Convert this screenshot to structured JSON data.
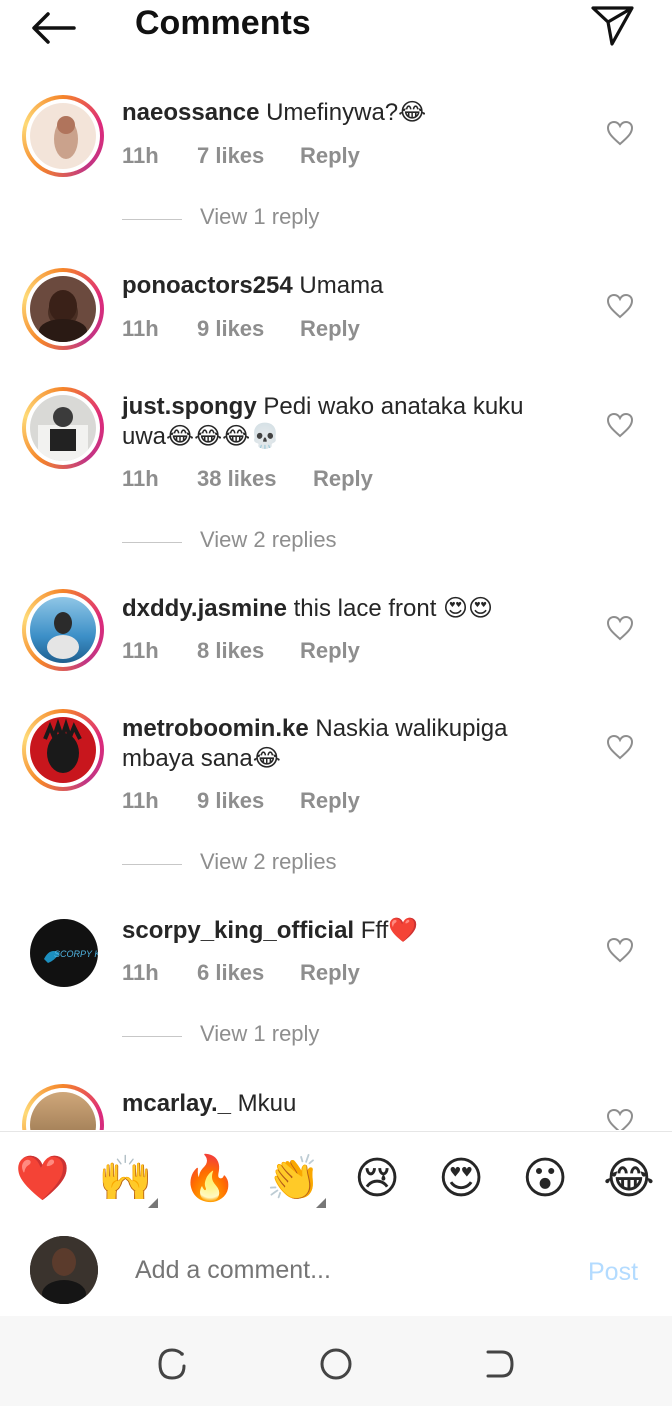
{
  "header": {
    "title": "Comments"
  },
  "comments": [
    {
      "username": "naeossance",
      "text": "Umefinywa?😂",
      "time": "11h",
      "likes": "7 likes",
      "reply": "Reply",
      "view_replies": "View 1 reply"
    },
    {
      "username": "ponoactors254",
      "text": "Umama",
      "time": "11h",
      "likes": "9 likes",
      "reply": "Reply"
    },
    {
      "username": "just.spongy",
      "text": "Pedi wako anataka kuku uwa😂😂😂💀",
      "time": "11h",
      "likes": "38 likes",
      "reply": "Reply",
      "view_replies": "View 2 replies"
    },
    {
      "username": "dxddy.jasmine",
      "text": "this lace front 😍😍",
      "time": "11h",
      "likes": "8 likes",
      "reply": "Reply"
    },
    {
      "username": "metroboomin.ke",
      "text": "Naskia walikupiga mbaya sana😂",
      "time": "11h",
      "likes": "9 likes",
      "reply": "Reply",
      "view_replies": "View 2 replies"
    },
    {
      "username": "scorpy_king_official",
      "text": "Fff❤️",
      "time": "11h",
      "likes": "6 likes",
      "reply": "Reply",
      "view_replies": "View 1 reply",
      "avatar_text": "SCORPY KING"
    },
    {
      "username": "mcarlay._",
      "text": "Mkuu"
    }
  ],
  "reactions": [
    "❤️",
    "🙌",
    "🔥",
    "👏",
    "😢",
    "😍",
    "😮",
    "😂"
  ],
  "composer": {
    "placeholder": "Add a comment...",
    "post_label": "Post"
  },
  "colors": {
    "story_ring": "#dd2a7b",
    "post_disabled": "#b3dbff",
    "muted": "#8e8e8e"
  }
}
